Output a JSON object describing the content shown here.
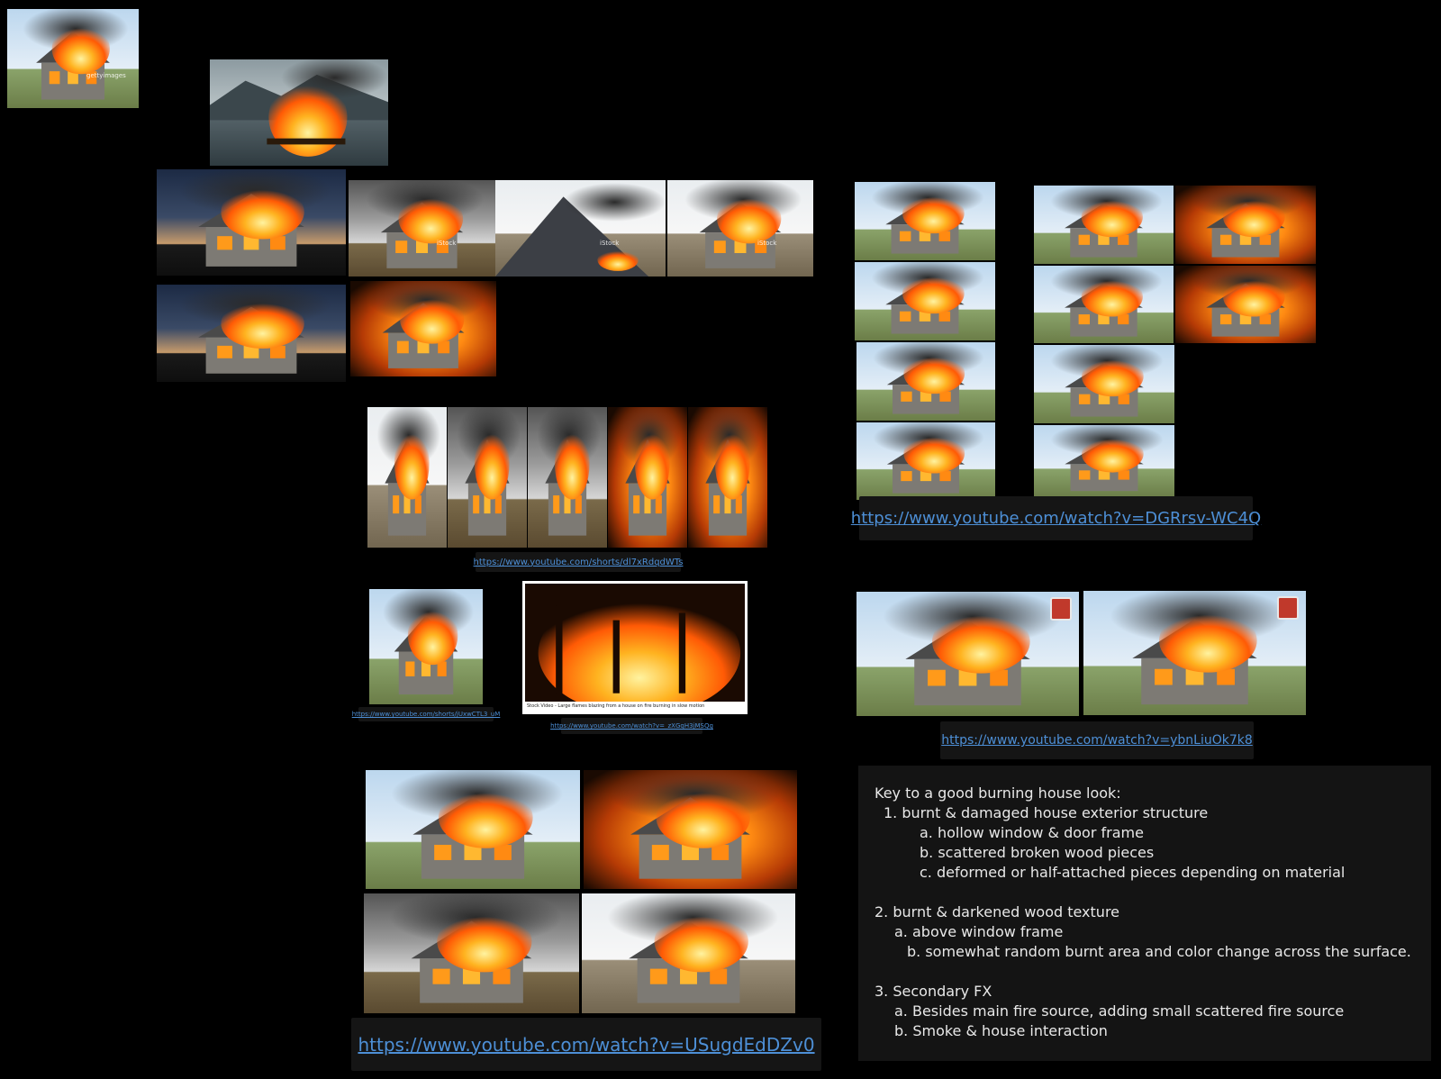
{
  "board": {
    "links": {
      "link_1": "https://www.youtube.com/shorts/dl7xRdqdWTs",
      "link_2": "https://www.youtube.com/watch?v=DGRrsv-WC4Q",
      "link_3": "https://www.youtube.com/shorts/jUxwCTL3_uM",
      "link_4": "https://www.youtube.com/watch?v=_zXGqH3jMSQg",
      "link_5": "https://www.youtube.com/watch?v=ybnLiuOk7k8",
      "link_6": "https://www.youtube.com/watch?v=USugdEdDZv0"
    },
    "captions": {
      "stock_video": "Stock Video - Large flames blazing from a house on fire burning in slow motion",
      "istock": "iStock",
      "getty": "gettyimages"
    }
  },
  "notes": {
    "heading": "Key to a good burning house look:",
    "item_1": "1. burnt & damaged house exterior structure",
    "item_1a": "a. hollow window & door frame",
    "item_1b": "b. scattered broken wood pieces",
    "item_1c": "c. deformed or half-attached pieces depending on material",
    "item_2": "2. burnt & darkened wood texture",
    "item_2a": "a. above window frame",
    "item_2b": "b. somewhat random burnt area and color change across the surface.",
    "item_3": "3. Secondary FX",
    "item_3a": "a. Besides main fire source, adding small scattered fire source",
    "item_3b": "b. Smoke & house interaction"
  },
  "colors": {
    "background": "#000000",
    "link": "#4d8fd6",
    "panel": "#141414",
    "fire": "#ff8a12"
  }
}
